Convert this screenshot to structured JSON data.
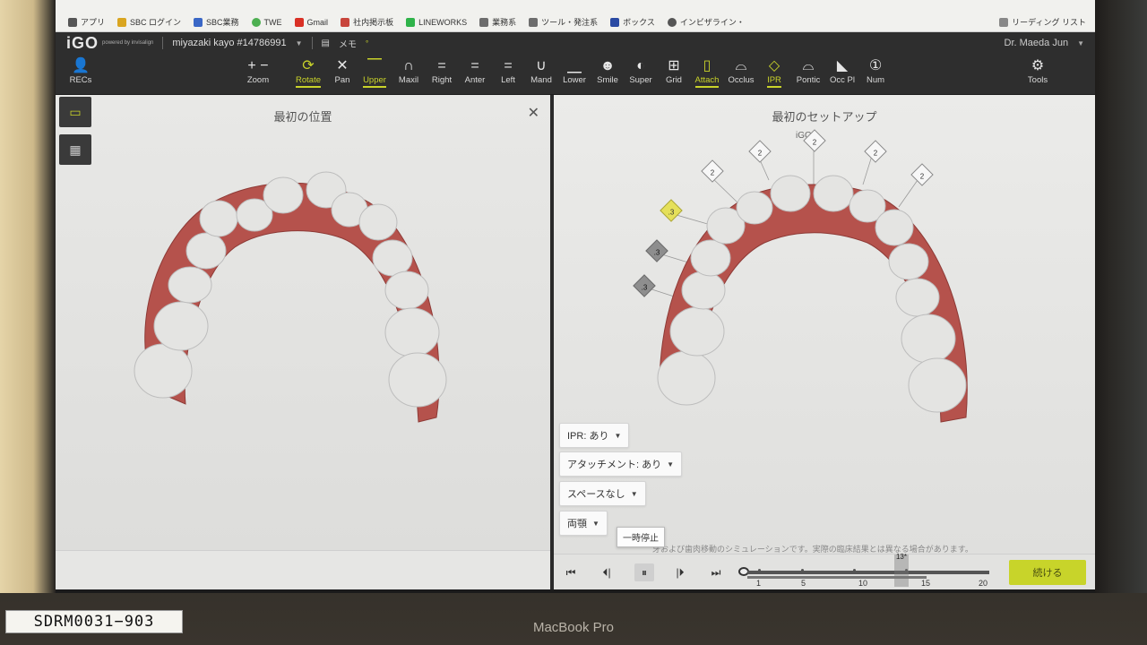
{
  "bookmarks": [
    {
      "label": "アプリ",
      "color": "#555555"
    },
    {
      "label": "SBC ログイン",
      "color": "#d9a520"
    },
    {
      "label": "SBC業務",
      "color": "#3a67c6"
    },
    {
      "label": "TWE",
      "color": "#4caf50"
    },
    {
      "label": "Gmail",
      "color": "#d93025"
    },
    {
      "label": "社内掲示板",
      "color": "#c8453b"
    },
    {
      "label": "LINEWORKS",
      "color": "#2fb34a"
    },
    {
      "label": "業務系",
      "color": "#6d6d6d"
    },
    {
      "label": "ツール・発注系",
      "color": "#6d6d6d"
    },
    {
      "label": "ボックス",
      "color": "#2a4aa3"
    },
    {
      "label": "インビザライン・",
      "color": "#555555"
    }
  ],
  "reading_list": "リーディング リスト",
  "app": {
    "logo": "iGO",
    "logo_sub": "powered by invisalign",
    "patient": "miyazaki kayo #14786991",
    "memo": "メモ",
    "doctor": "Dr. Maeda Jun"
  },
  "toolbar": [
    {
      "id": "recs",
      "label": "RECs",
      "glyph": "👤",
      "active": false
    },
    {
      "id": "zoom",
      "label": "Zoom",
      "glyph": "+ −",
      "active": false
    },
    {
      "id": "rotate",
      "label": "Rotate",
      "glyph": "⟳",
      "active": true
    },
    {
      "id": "pan",
      "label": "Pan",
      "glyph": "✕",
      "active": false
    },
    {
      "id": "upper",
      "label": "Upper",
      "glyph": "⎺",
      "active": true
    },
    {
      "id": "maxil",
      "label": "Maxil",
      "glyph": "∩",
      "active": false
    },
    {
      "id": "right",
      "label": "Right",
      "glyph": "=",
      "active": false
    },
    {
      "id": "anter",
      "label": "Anter",
      "glyph": "=",
      "active": false
    },
    {
      "id": "left",
      "label": "Left",
      "glyph": "=",
      "active": false
    },
    {
      "id": "mand",
      "label": "Mand",
      "glyph": "∪",
      "active": false
    },
    {
      "id": "lower",
      "label": "Lower",
      "glyph": "⎽",
      "active": false
    },
    {
      "id": "smile",
      "label": "Smile",
      "glyph": "☻",
      "active": false
    },
    {
      "id": "super",
      "label": "Super",
      "glyph": "◐",
      "active": false
    },
    {
      "id": "grid",
      "label": "Grid",
      "glyph": "⊞",
      "active": false
    },
    {
      "id": "attach",
      "label": "Attach",
      "glyph": "▯",
      "active": true
    },
    {
      "id": "occlus",
      "label": "Occlus",
      "glyph": "⌓",
      "active": false
    },
    {
      "id": "ipr",
      "label": "IPR",
      "glyph": "◇",
      "active": true
    },
    {
      "id": "pontic",
      "label": "Pontic",
      "glyph": "⌓",
      "active": false
    },
    {
      "id": "occpl",
      "label": "Occ Pl",
      "glyph": "◣",
      "active": false
    },
    {
      "id": "num",
      "label": "Num",
      "glyph": "①",
      "active": false
    },
    {
      "id": "tools",
      "label": "Tools",
      "glyph": "⚙",
      "active": false
    }
  ],
  "left_pane": {
    "title": "最初の位置"
  },
  "right_pane": {
    "title": "最初のセットアップ",
    "mark": "iGO"
  },
  "ipr_tags": [
    {
      "value": "2",
      "style": "white"
    },
    {
      "value": "2",
      "style": "white"
    },
    {
      "value": "2",
      "style": "white"
    },
    {
      "value": "2",
      "style": "white"
    },
    {
      "value": "2",
      "style": "white"
    },
    {
      "value": ".3",
      "style": "yellow"
    },
    {
      "value": ".3",
      "style": "gray"
    },
    {
      "value": ".3",
      "style": "gray"
    }
  ],
  "dropdowns": {
    "ipr": "IPR: あり",
    "attachment": "アタッチメント: あり",
    "space": "スペースなし",
    "jaw": "両顎"
  },
  "tooltip": "一時停止",
  "disclaimer": "牙および歯肉移動のシミュレーションです。実際の臨床結果とは異なる場合があります。",
  "timeline": {
    "ticks": [
      "1",
      "5",
      "10",
      "15",
      "20"
    ],
    "current": "13*",
    "continue_label": "続ける"
  },
  "sticker": "SDRM0031−903",
  "brand": "MacBook Pro",
  "colors": {
    "accent": "#c9d32a",
    "gum": "#b5524c",
    "tooth": "#e4e4e2"
  }
}
